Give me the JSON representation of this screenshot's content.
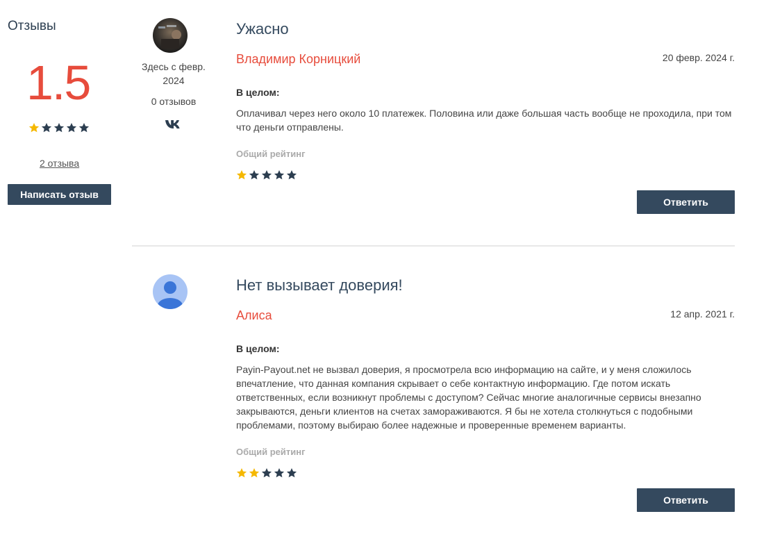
{
  "sidebar": {
    "title": "Отзывы",
    "score": "1.5",
    "stars_filled": 1,
    "stars_total": 5,
    "reviews_count": "2 отзыва",
    "write_button": "Написать отзыв"
  },
  "colors": {
    "accent": "#e74c3c",
    "star_filled": "#f5b800",
    "star_empty": "#2c3e50",
    "button_bg": "#34495e"
  },
  "reviews": [
    {
      "title": "Ужасно",
      "author": "Владимир Корницкий",
      "date": "20 февр. 2024 г.",
      "member_since": "Здесь с февр. 2024",
      "author_reviews": "0 отзывов",
      "social_icon": "vk-icon",
      "overall_label": "В целом:",
      "text": "Оплачивал через него около 10 платежек. Половина или даже большая часть вообще не проходила, при том что деньги отправлены.",
      "rating_label": "Общий рейтинг",
      "stars_filled": 1,
      "stars_total": 5,
      "reply_button": "Ответить"
    },
    {
      "title": "Нет вызывает доверия!",
      "author": "Алиса",
      "date": "12 апр. 2021 г.",
      "overall_label": "В целом:",
      "text": "Payin-Payout.net не вызвал доверия, я просмотрела всю информацию на сайте, и у меня сложилось впечатление, что данная компания скрывает о себе контактную информацию. Где потом искать ответственных, если возникнут проблемы с доступом? Сейчас многие аналогичные сервисы внезапно закрываются, деньги клиентов на счетах замораживаются. Я бы не хотела столкнуться с подобными проблемами, поэтому выбираю более надежные и проверенные временем варианты.",
      "rating_label": "Общий рейтинг",
      "stars_filled": 2,
      "stars_total": 5,
      "reply_button": "Ответить"
    }
  ]
}
